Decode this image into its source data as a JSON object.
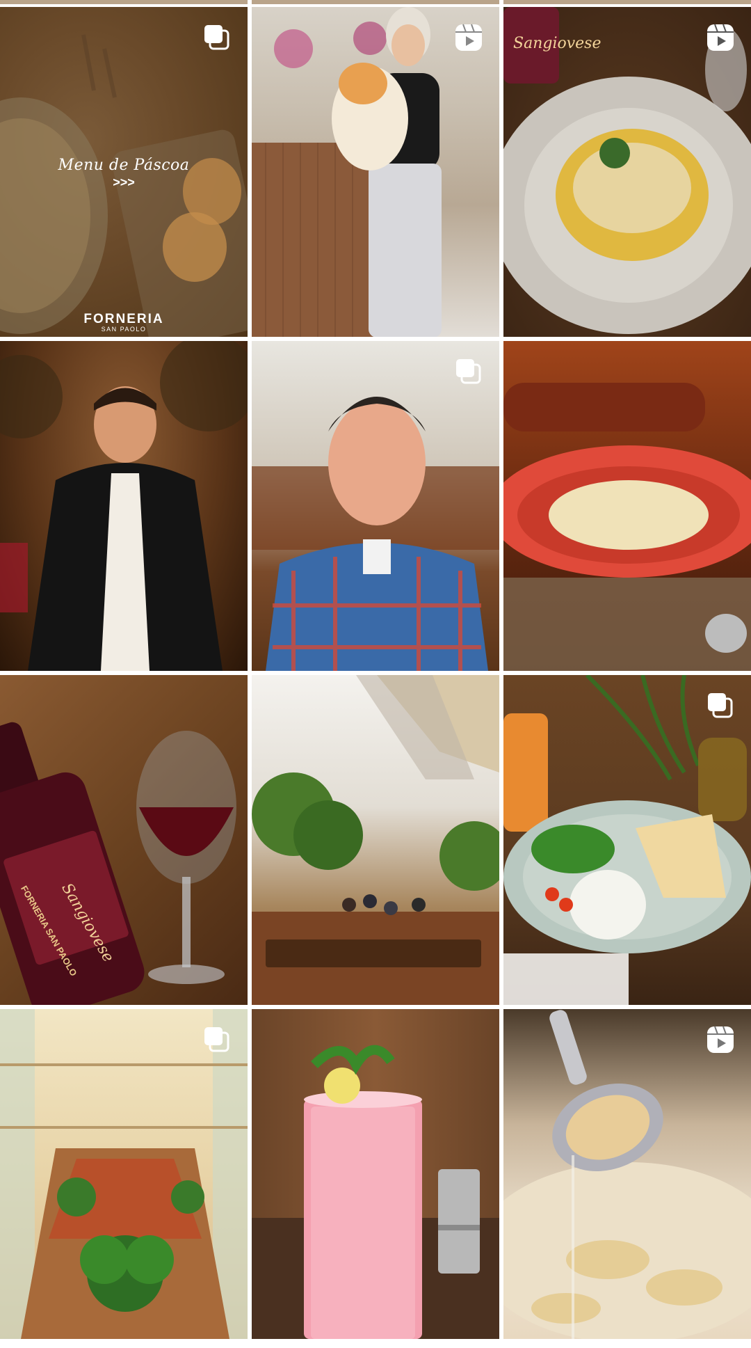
{
  "top_strip": {
    "colors": [
      "#b9a48a",
      "#c7b39a",
      "#b48f72"
    ]
  },
  "posts": [
    {
      "name": "post-menu-pascoa",
      "type": "carousel",
      "overlay": {
        "title": "Menu de Páscoa",
        "arrows": ">>>",
        "brand": "FORNERIA",
        "brand_sub": "SAN PAOLO"
      }
    },
    {
      "name": "post-woman-with-dog",
      "type": "reel"
    },
    {
      "name": "post-pasta-carbonara",
      "type": "reel",
      "bottle_label": "Sangiovese"
    },
    {
      "name": "post-man-in-suit",
      "type": "single"
    },
    {
      "name": "post-man-plaid-shirt",
      "type": "carousel"
    },
    {
      "name": "post-spaghetti-red-plate",
      "type": "single"
    },
    {
      "name": "post-red-wine",
      "type": "single",
      "bottle_label": "FORNERIA SAN PAOLO",
      "bottle_script": "Sangiovese"
    },
    {
      "name": "post-restaurant-interior",
      "type": "single"
    },
    {
      "name": "post-burrata-focaccia",
      "type": "carousel"
    },
    {
      "name": "post-mall-illustration",
      "type": "carousel"
    },
    {
      "name": "post-pink-drink",
      "type": "single"
    },
    {
      "name": "post-tortellini-spoon",
      "type": "reel"
    }
  ],
  "icons": {
    "carousel": "carousel-icon",
    "reel": "reel-icon"
  }
}
